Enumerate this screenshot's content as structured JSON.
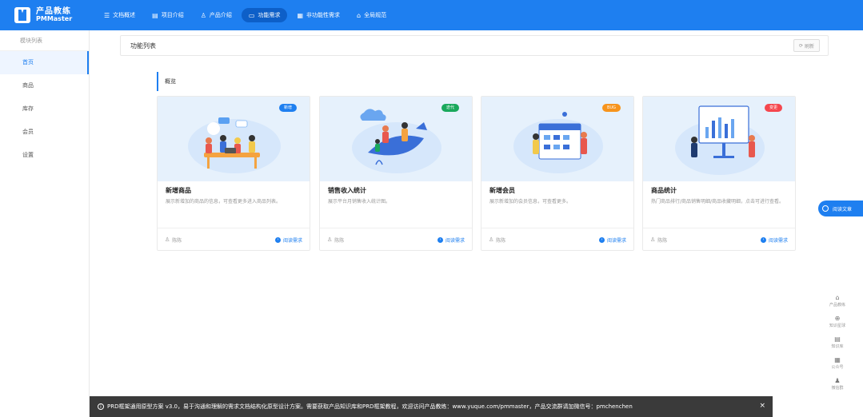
{
  "brand": {
    "name_cn": "产品教练",
    "name_en": "PMMaster"
  },
  "nav": [
    {
      "icon": "☰",
      "label": "文档概述",
      "active": false
    },
    {
      "icon": "▤",
      "label": "项目介绍",
      "active": false
    },
    {
      "icon": "♙",
      "label": "产品介绍",
      "active": false
    },
    {
      "icon": "▭",
      "label": "功能需求",
      "active": true
    },
    {
      "icon": "▦",
      "label": "非功能性需求",
      "active": false
    },
    {
      "icon": "⌂",
      "label": "全局规范",
      "active": false
    }
  ],
  "sidebar": {
    "header": "模块列表",
    "items": [
      {
        "label": "首页",
        "active": true
      },
      {
        "label": "商品",
        "active": false
      },
      {
        "label": "库存",
        "active": false
      },
      {
        "label": "会员",
        "active": false
      },
      {
        "label": "设置",
        "active": false
      }
    ]
  },
  "main": {
    "title": "功能列表",
    "refresh_label": "刷新",
    "section_title": "概览"
  },
  "cards": [
    {
      "badge": "新增",
      "badge_color": "#1e7ff0",
      "title": "新增商品",
      "desc": "展示新增加的商品的信息，可查看更多进入商品列表。",
      "author": "陈陈",
      "link": "阅读需求"
    },
    {
      "badge": "迭代",
      "badge_color": "#1aa85c",
      "title": "销售收入统计",
      "desc": "展示平台月销售收入统计图。",
      "author": "陈陈",
      "link": "阅读需求"
    },
    {
      "badge": "BUG",
      "badge_color": "#f7941d",
      "title": "新增会员",
      "desc": "展示新增加的会员信息，可查看更多。",
      "author": "陈陈",
      "link": "阅读需求"
    },
    {
      "badge": "变更",
      "badge_color": "#f5474e",
      "title": "商品统计",
      "desc": "热门商品排行/商品销售明细/商品收藏明细，点击可进行查看。",
      "author": "陈陈",
      "link": "阅读需求"
    }
  ],
  "float_button": {
    "label": "阅读文章"
  },
  "right_tools": [
    {
      "icon": "⌂",
      "label": "产品教练"
    },
    {
      "icon": "⊕",
      "label": "知识星球"
    },
    {
      "icon": "▤",
      "label": "知识库"
    },
    {
      "icon": "▦",
      "label": "公众号"
    },
    {
      "icon": "♟",
      "label": "微信群"
    }
  ],
  "notice": {
    "text": "PRD框架通用原型方案 v3.0，易于沟通和理解的需求文档结构化原型设计方案。需要获取产品知识库和PRD框架教程，欢迎访问产品教练：www.yuque.com/pmmaster，产品交流群请加微信号：pmchenchen",
    "close": "×"
  }
}
